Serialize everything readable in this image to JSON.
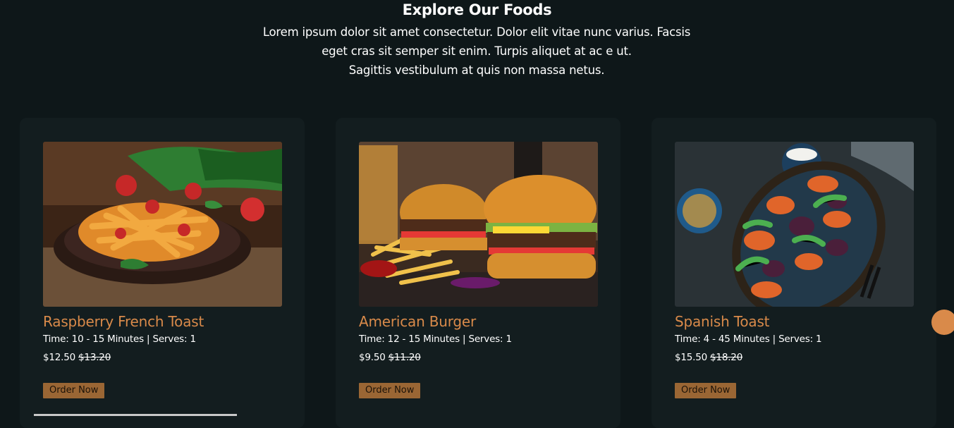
{
  "section": {
    "title": "Explore Our Foods",
    "subtitle_lines": [
      "Lorem ipsum dolor sit amet consectetur. Dolor elit vitae nunc varius. Facsis",
      "eget cras sit semper sit enim. Turpis aliquet at ac e ut.",
      "Sagittis vestibulum at quis non massa netus."
    ]
  },
  "cards": [
    {
      "title": "Raspberry French Toast",
      "meta": "Time: 10 - 15 Minutes | Serves: 1",
      "price": "$12.50",
      "old_price": "$13.20",
      "button": "Order Now",
      "image": "pasta-with-tomatoes-photo"
    },
    {
      "title": "American Burger",
      "meta": "Time: 12 - 15 Minutes | Serves: 1",
      "price": "$9.50",
      "old_price": "$11.20",
      "button": "Order Now",
      "image": "burgers-and-fries-photo"
    },
    {
      "title": "Spanish Toast",
      "meta": "Time: 4 - 45 Minutes | Serves: 1",
      "price": "$15.50",
      "old_price": "$18.20",
      "button": "Order Now",
      "image": "roasted-vegetable-salad-photo"
    }
  ],
  "colors": {
    "background": "#0e1719",
    "card": "#131d1f",
    "accent": "#d98a4a",
    "button": "#9a6634"
  }
}
